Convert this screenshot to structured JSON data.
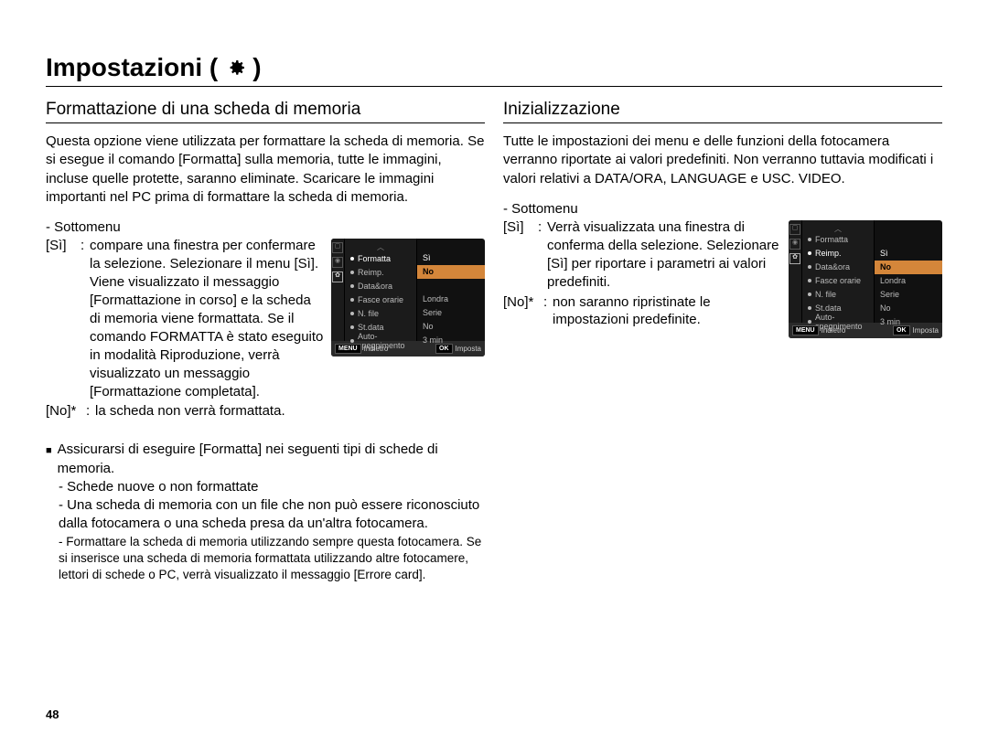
{
  "page_number": "48",
  "title": "Impostazioni (",
  "title_close": ")",
  "left": {
    "heading": "Formattazione di una scheda di memoria",
    "intro": "Questa opzione viene utilizzata per formattare la scheda di memoria. Se si esegue il comando [Formatta] sulla memoria, tutte le immagini, incluse quelle protette, saranno eliminate. Scaricare le immagini importanti nel PC prima di formattare la scheda di memoria.",
    "submenu_label": "- Sottomenu",
    "items": [
      {
        "key": "[Sì]",
        "sep": ":",
        "text": "compare una finestra per confermare la selezione. Selezionare il menu [Sì]. Viene visualizzato il messaggio [Formattazione in corso] e la scheda di memoria viene formattata. Se il comando FORMATTA è stato eseguito in modalità Riproduzione, verrà visualizzato un messaggio [Formattazione completata]."
      },
      {
        "key": "[No]*",
        "sep": ":",
        "text": "la scheda non verrà formattata."
      }
    ],
    "note_lead": "Assicurarsi di eseguire [Formatta] nei seguenti tipi di schede di memoria.",
    "note_bullets": [
      "- Schede nuove o non formattate",
      "- Una scheda di memoria con un file che non può essere riconosciuto dalla fotocamera o una scheda presa da un'altra fotocamera."
    ],
    "note_small": "- Formattare la scheda di memoria utilizzando sempre questa fotocamera. Se si inserisce una scheda di memoria formattata utilizzando altre fotocamere, lettori di schede o PC, verrà visualizzato il messaggio [Errore card].",
    "camera": {
      "menu_items": [
        "Formatta",
        "Reimp.",
        "Data&ora",
        "Fasce orarie",
        "N. file",
        "St.data",
        "Auto-spegnimento"
      ],
      "selected_index": 0,
      "right_values": [
        "",
        "",
        "",
        "Londra",
        "Serie",
        "No",
        "3 min"
      ],
      "options": [
        "Sì",
        "No"
      ],
      "option_hi": 1,
      "status_left": "Indietro",
      "status_right": "Imposta",
      "status_menu": "MENU",
      "status_ok": "OK"
    }
  },
  "right": {
    "heading": "Inizializzazione",
    "intro": "Tutte le impostazioni dei menu e delle funzioni della fotocamera verranno riportate ai valori predefiniti. Non verranno tuttavia modificati i valori relativi a DATA/ORA, LANGUAGE e USC. VIDEO.",
    "submenu_label": "- Sottomenu",
    "items": [
      {
        "key": "[Sì]",
        "sep": ":",
        "text": "Verrà visualizzata una finestra di conferma della selezione. Selezionare [Sì] per riportare i parametri ai valori predefiniti."
      },
      {
        "key": "[No]*",
        "sep": ":",
        "text": "non saranno ripristinate le impostazioni predefinite."
      }
    ],
    "camera": {
      "menu_items": [
        "Formatta",
        "Reimp.",
        "Data&ora",
        "Fasce orarie",
        "N. file",
        "St.data",
        "Auto-spegnimento"
      ],
      "selected_index": 1,
      "right_values": [
        "",
        "",
        "",
        "Londra",
        "Serie",
        "No",
        "3 min"
      ],
      "options": [
        "Sì",
        "No"
      ],
      "option_hi": 1,
      "status_left": "Indietro",
      "status_right": "Imposta",
      "status_menu": "MENU",
      "status_ok": "OK"
    }
  }
}
